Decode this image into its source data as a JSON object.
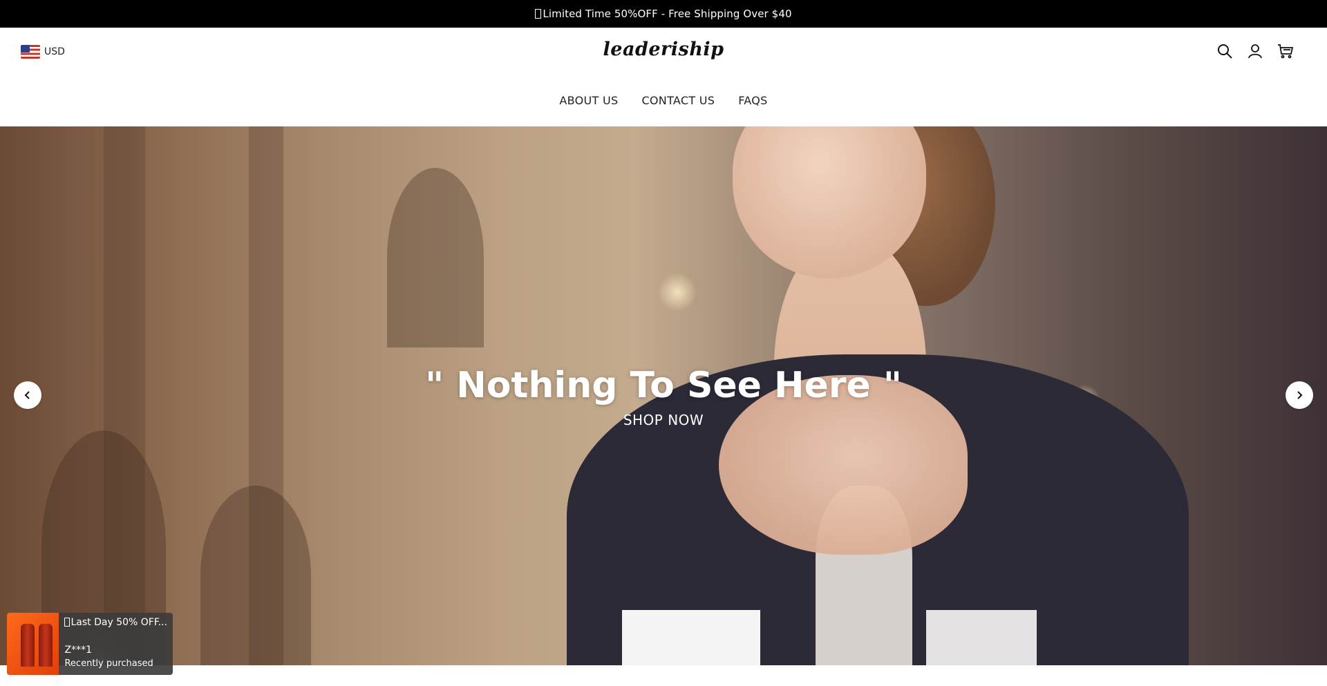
{
  "announcement": {
    "text": "Limited Time 50%OFF - Free Shipping Over $40"
  },
  "header": {
    "currency": "USD",
    "logo": "leaderiship",
    "nav": [
      {
        "label": "ABOUT US"
      },
      {
        "label": "CONTACT US"
      },
      {
        "label": "FAQS"
      }
    ],
    "icons": [
      "search-icon",
      "account-icon",
      "cart-icon"
    ]
  },
  "hero": {
    "title": "\" Nothing To See Here \"",
    "cta": "SHOP NOW",
    "arrows": [
      "chevron-left-icon",
      "chevron-right-icon"
    ]
  },
  "popup": {
    "title": "Last Day 50% OFF...",
    "buyer": "Z***1",
    "status": "Recently purchased"
  }
}
